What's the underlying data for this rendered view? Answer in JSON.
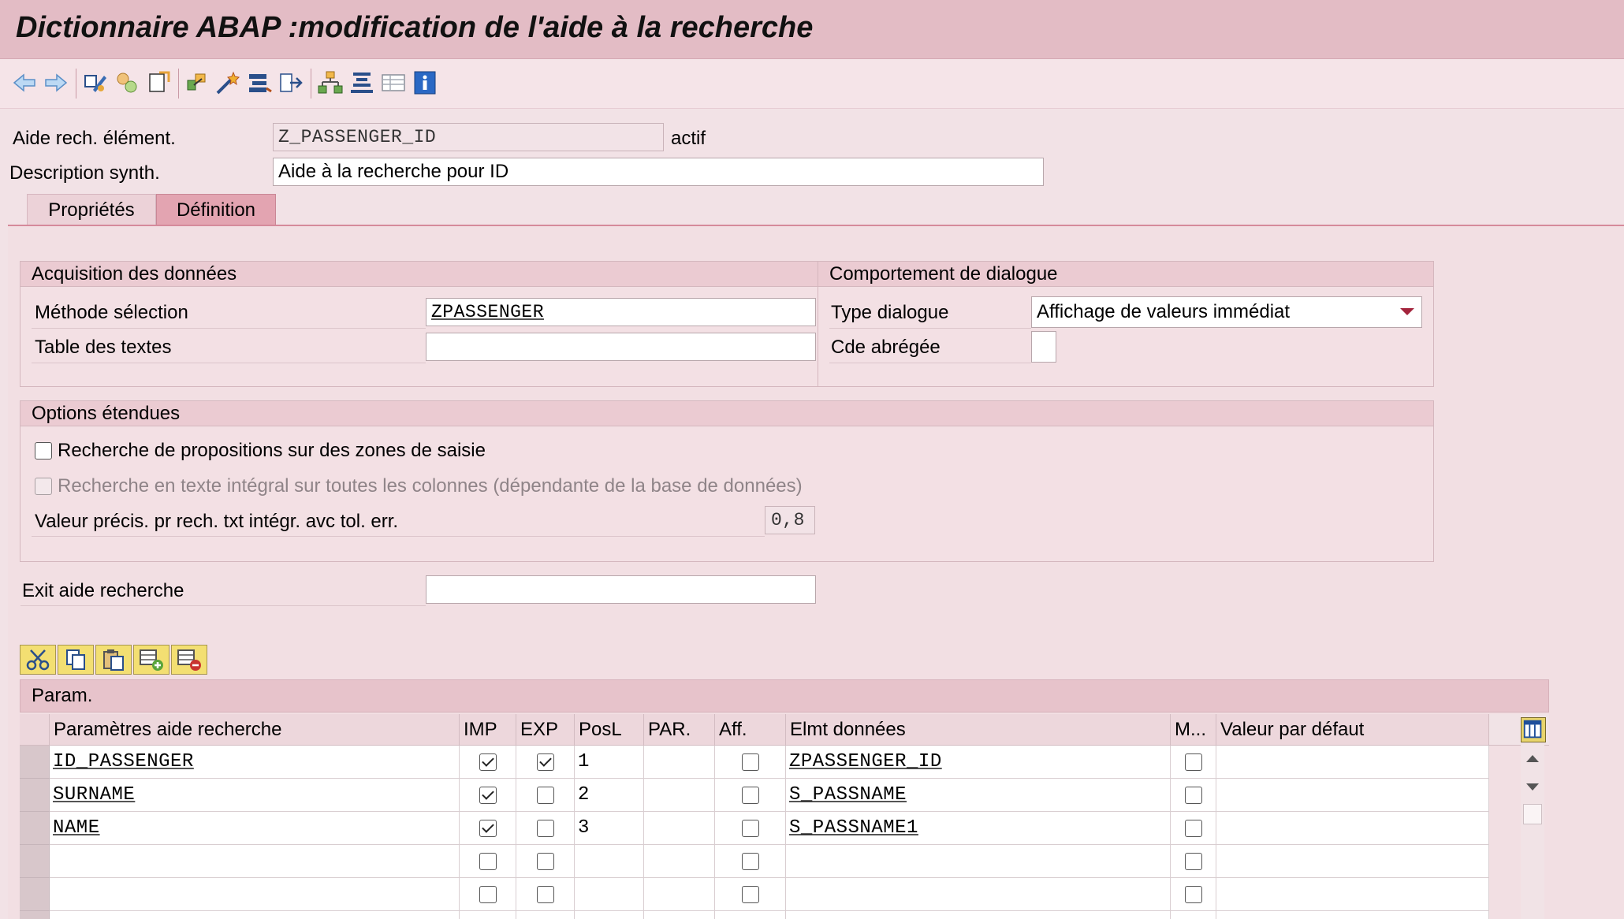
{
  "window": {
    "title": "Dictionnaire ABAP :modification de l'aide à la recherche"
  },
  "toolbar": {
    "icons": [
      "back-arrow-icon",
      "forward-arrow-icon",
      "display-change-icon",
      "other-object-icon",
      "activate-icon",
      "check-icon",
      "test-icon",
      "where-used-icon",
      "move-icon",
      "hierarchy-icon",
      "align-icon",
      "list-icon",
      "info-icon"
    ]
  },
  "header": {
    "elem_label": "Aide rech. élément.",
    "elem_value": "Z_PASSENGER_ID",
    "status": "actif",
    "desc_label": "Description synth.",
    "desc_value": "Aide à la recherche pour ID"
  },
  "tabs": [
    {
      "label": "Propriétés",
      "active": false
    },
    {
      "label": "Définition",
      "active": true
    }
  ],
  "acquisition": {
    "title": "Acquisition des données",
    "method_label": "Méthode sélection",
    "method_value": "ZPASSENGER",
    "text_table_label": "Table des textes",
    "text_table_value": ""
  },
  "dialog": {
    "title": "Comportement de dialogue",
    "type_label": "Type dialogue",
    "type_value": "Affichage de valeurs immédiat",
    "short_label": "Cde abrégée",
    "short_value": ""
  },
  "options": {
    "title": "Options étendues",
    "opt1_label": "Recherche de propositions sur des zones de saisie",
    "opt1_checked": false,
    "opt2_label": "Recherche en texte intégral sur toutes les colonnes (dépendante de la base de données)",
    "opt2_checked": false,
    "precision_label": "Valeur précis. pr rech. txt intégr. avc tol. err.",
    "precision_value": "0,8"
  },
  "exit": {
    "label": "Exit aide recherche",
    "value": ""
  },
  "params": {
    "title": "Param.",
    "columns": [
      "Paramètres aide recherche",
      "IMP",
      "EXP",
      "PosL",
      "PAR.",
      "Aff.",
      "Elmt données",
      "M...",
      "Valeur par défaut"
    ],
    "rows": [
      {
        "param": "ID_PASSENGER",
        "imp": true,
        "exp": true,
        "posl": "1",
        "par": "",
        "aff": false,
        "elmt": "ZPASSENGER_ID",
        "m": false,
        "def": ""
      },
      {
        "param": "SURNAME",
        "imp": true,
        "exp": false,
        "posl": "2",
        "par": "",
        "aff": false,
        "elmt": "S_PASSNAME",
        "m": false,
        "def": ""
      },
      {
        "param": "NAME",
        "imp": true,
        "exp": false,
        "posl": "3",
        "par": "",
        "aff": false,
        "elmt": "S_PASSNAME1",
        "m": false,
        "def": ""
      },
      {
        "param": "",
        "imp": false,
        "exp": false,
        "posl": "",
        "par": "",
        "aff": false,
        "elmt": "",
        "m": false,
        "def": ""
      },
      {
        "param": "",
        "imp": false,
        "exp": false,
        "posl": "",
        "par": "",
        "aff": false,
        "elmt": "",
        "m": false,
        "def": ""
      },
      {
        "param": "",
        "imp": false,
        "exp": false,
        "posl": "",
        "par": "",
        "aff": false,
        "elmt": "",
        "m": false,
        "def": ""
      }
    ]
  },
  "colors": {
    "title_bar": "#e3bcc5",
    "body": "#f2e2e6",
    "active_tab": "#e3a4b1",
    "table_button": "#f3df72",
    "accent": "#a3243c"
  }
}
